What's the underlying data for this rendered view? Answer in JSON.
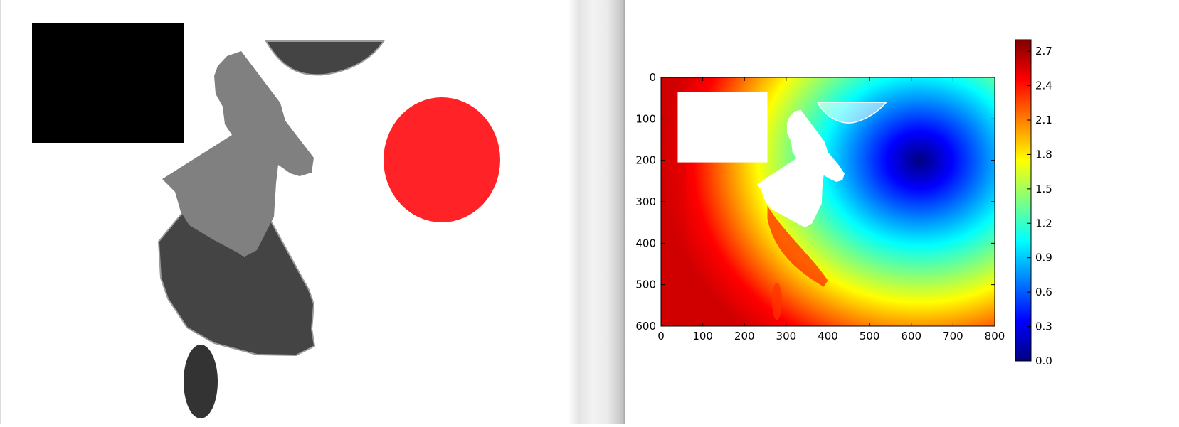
{
  "colors": {
    "black_rect": "#000000",
    "light_gray_shape": "#808080",
    "dark_gray_shape": "#444444",
    "ellipse_gray": "#333333",
    "red_circle": "#ff2227",
    "background": "#ffffff"
  },
  "chart_data": {
    "type": "heatmap",
    "colormap": "jet",
    "title": "",
    "xlabel": "",
    "ylabel": "",
    "x_range": [
      0,
      800
    ],
    "y_range": [
      0,
      600
    ],
    "y_inverted": true,
    "xticks": [
      0,
      100,
      200,
      300,
      400,
      500,
      600,
      700,
      800
    ],
    "yticks": [
      0,
      100,
      200,
      300,
      400,
      500,
      600
    ],
    "colorbar": {
      "range": [
        0.0,
        2.8
      ],
      "ticks": [
        "0.0",
        "0.3",
        "0.6",
        "0.9",
        "1.2",
        "1.5",
        "1.8",
        "2.1",
        "2.4",
        "2.7"
      ],
      "placement": "right"
    },
    "field": {
      "minimum": {
        "x": 620,
        "y": 200,
        "value": 0.0
      },
      "maximum_value": 2.8,
      "maximum_location": "left edge (x = 0)"
    },
    "masked_regions": [
      {
        "shape": "rectangle",
        "x": [
          40,
          255
        ],
        "y": [
          35,
          205
        ]
      },
      {
        "shape": "half-ellipse",
        "x": [
          375,
          540
        ],
        "y": [
          60,
          110
        ]
      },
      {
        "shape": "irregular",
        "x": [
          225,
          440
        ],
        "y": [
          75,
          365
        ]
      }
    ]
  }
}
